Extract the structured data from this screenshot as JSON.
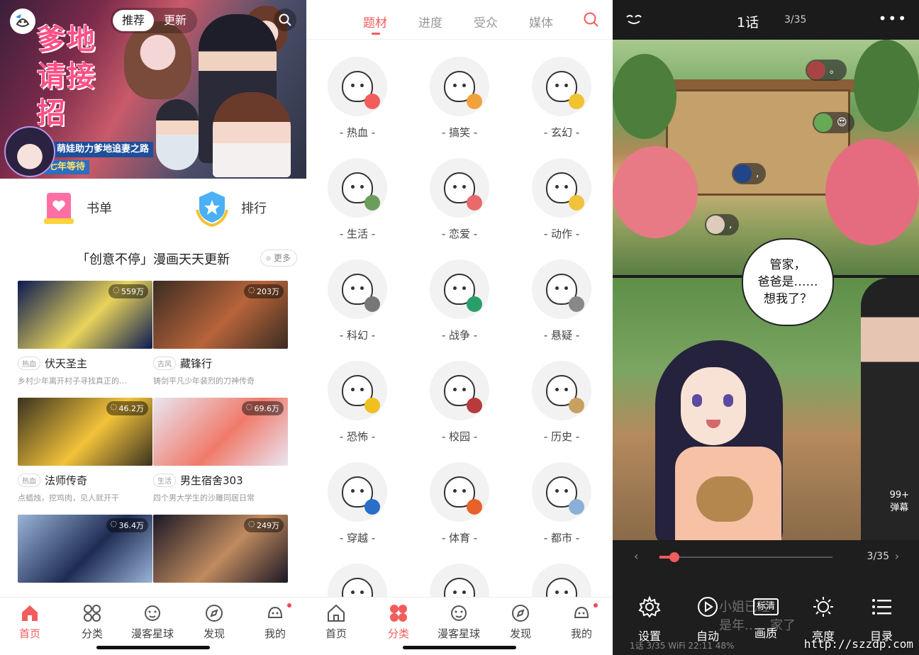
{
  "home": {
    "segments": [
      "推荐",
      "更新"
    ],
    "banner": {
      "title_art": "爹地请接招",
      "tagline": "萌娃助力爹地追妻之路",
      "subtag": "七年等待"
    },
    "quick": [
      {
        "label": "书单",
        "icon": "booklist-icon"
      },
      {
        "label": "排行",
        "icon": "ranking-icon"
      }
    ],
    "section_title": "「创意不停」漫画天天更新",
    "more_label": "更多",
    "cards": [
      {
        "views": "559万",
        "tag": "热血",
        "name": "伏天圣主",
        "desc": "乡村少年离开村子寻找真正的…",
        "palette": [
          "#0b1a52",
          "#e8d35a"
        ]
      },
      {
        "views": "203万",
        "tag": "古风",
        "name": "藏锋行",
        "desc": "铸剑平凡少年装烈的刀神传奇",
        "palette": [
          "#3a2c22",
          "#b8643a"
        ]
      },
      {
        "views": "46.2万",
        "tag": "热血",
        "name": "法师传奇",
        "desc": "点蜡烛，挖鸡肉，见人就开干",
        "palette": [
          "#3a3220",
          "#f2c23a"
        ]
      },
      {
        "views": "69.6万",
        "tag": "生活",
        "name": "男生宿舍303",
        "desc": "四个男大学生的沙雕同居日常",
        "palette": [
          "#e9e6f2",
          "#f07a6a"
        ]
      },
      {
        "views": "36.4万",
        "tag": "",
        "name": "",
        "desc": "",
        "palette": [
          "#9ab4d6",
          "#1e2c54"
        ]
      },
      {
        "views": "249万",
        "tag": "",
        "name": "",
        "desc": "",
        "palette": [
          "#1a1826",
          "#c08a5e"
        ]
      }
    ],
    "tabs": [
      {
        "label": "首页",
        "icon": "home-icon",
        "active": true
      },
      {
        "label": "分类",
        "icon": "category-icon",
        "active": false
      },
      {
        "label": "漫客星球",
        "icon": "planet-icon",
        "active": false
      },
      {
        "label": "发现",
        "icon": "discover-icon",
        "active": false
      },
      {
        "label": "我的",
        "icon": "profile-icon",
        "active": false
      }
    ]
  },
  "category": {
    "tabs": [
      "题材",
      "进度",
      "受众",
      "媒体"
    ],
    "active_tab": "题材",
    "genres": [
      "- 热血 -",
      "- 搞笑 -",
      "- 玄幻 -",
      "- 生活 -",
      "- 恋爱 -",
      "- 动作 -",
      "- 科幻 -",
      "- 战争 -",
      "- 悬疑 -",
      "- 恐怖 -",
      "- 校园 -",
      "- 历史 -",
      "- 穿越 -",
      "- 体育 -",
      "- 都市 -"
    ],
    "tabs_bottom": [
      {
        "label": "首页",
        "icon": "home-icon",
        "active": false
      },
      {
        "label": "分类",
        "icon": "category-icon",
        "active": true
      },
      {
        "label": "漫客星球",
        "icon": "planet-icon",
        "active": false
      },
      {
        "label": "发现",
        "icon": "discover-icon",
        "active": false
      },
      {
        "label": "我的",
        "icon": "profile-icon",
        "active": false
      }
    ]
  },
  "reader": {
    "chapter": "1话",
    "page": "3/35",
    "speech": [
      "管家，",
      "爸爸是……",
      "想我了？"
    ],
    "faded_text": [
      "小姐已经",
      "是年……家了"
    ],
    "danmu_count": "99+",
    "danmu_label": "弹幕",
    "slider_page": "3/35",
    "progress": 0.086,
    "tools": [
      {
        "label": "设置",
        "icon": "settings-icon"
      },
      {
        "label": "自动",
        "icon": "play-icon"
      },
      {
        "label": "画质",
        "icon": "quality-icon",
        "badge": "标清"
      },
      {
        "label": "亮度",
        "icon": "brightness-icon"
      },
      {
        "label": "目录",
        "icon": "list-icon"
      }
    ],
    "status": "1话   3/35   WiFi 22:11  48%",
    "watermark": "http://szzdp.com"
  },
  "colors": {
    "accent": "#f25c5c",
    "dark": "#1e1e1e"
  }
}
